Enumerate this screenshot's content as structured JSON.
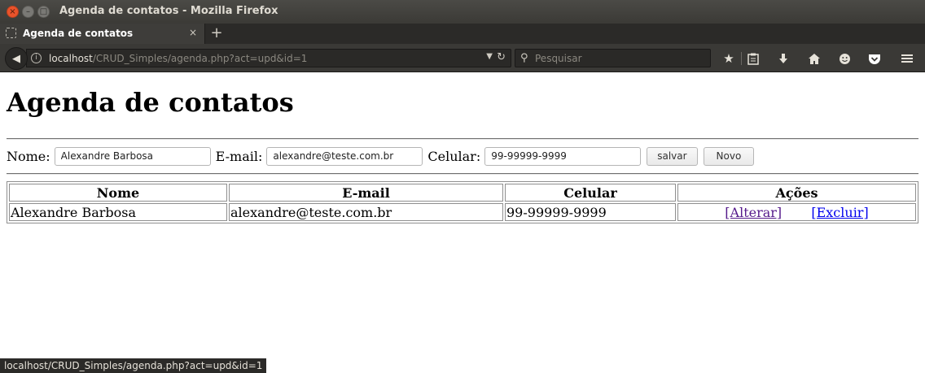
{
  "window": {
    "title": "Agenda de contatos - Mozilla Firefox"
  },
  "tabs": [
    {
      "label": "Agenda de contatos",
      "close": "×"
    }
  ],
  "new_tab": "+",
  "nav": {
    "back": "◀",
    "url_host": "localhost",
    "url_path": "/CRUD_Simples/agenda.php?act=upd&id=1",
    "search_placeholder": "Pesquisar"
  },
  "page": {
    "heading": "Agenda de contatos",
    "form": {
      "nome_label": "Nome:",
      "nome_value": "Alexandre Barbosa",
      "email_label": "E-mail:",
      "email_value": "alexandre@teste.com.br",
      "celular_label": "Celular:",
      "celular_value": "99-99999-9999",
      "save_label": "salvar",
      "new_label": "Novo"
    },
    "table": {
      "headers": [
        "Nome",
        "E-mail",
        "Celular",
        "Ações"
      ],
      "rows": [
        {
          "nome": "Alexandre Barbosa",
          "email": "alexandre@teste.com.br",
          "celular": "99-99999-9999",
          "alterar": "[Alterar]",
          "excluir": "[Excluir]"
        }
      ]
    }
  },
  "status_bar": "localhost/CRUD_Simples/agenda.php?act=upd&id=1"
}
